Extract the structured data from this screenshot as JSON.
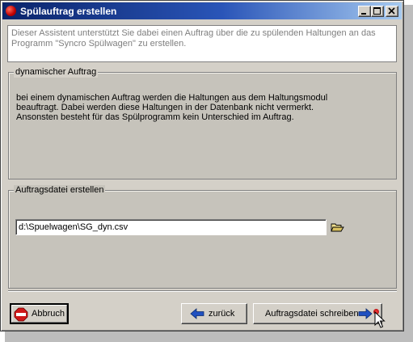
{
  "window": {
    "title": "Spülauftrag erstellen"
  },
  "intro_text": "Dieser Assistent unterstützt Sie dabei einen Auftrag über die zu spülenden Haltungen an das Programm \"Syncro Spülwagen\" zu erstellen.",
  "dynamic_group": {
    "legend": "dynamischer Auftrag",
    "description_lines": [
      "bei einem dynamischen Auftrag werden die Haltungen aus dem Haltungsmodul",
      "beauftragt. Dabei werden diese Haltungen in der Datenbank nicht vermerkt.",
      "Ansonsten besteht für das Spülprogramm kein Unterschied im Auftrag."
    ]
  },
  "file_group": {
    "legend": "Auftragsdatei erstellen",
    "path_value": "d:\\Spuelwagen\\SG_dyn.csv"
  },
  "buttons": {
    "abort_label": "Abbruch",
    "back_label": "zurück",
    "write_label": "Auftragsdatei schreiben"
  },
  "icons": {
    "app": "stop-sign-icon",
    "abort": "stop-sign-icon",
    "back": "arrow-left-icon",
    "write": "arrow-right-icon",
    "browse": "folder-open-icon"
  },
  "colors": {
    "titlebar_start": "#0a246a",
    "titlebar_end": "#a6caf0",
    "intro_text": "#7f7f7f",
    "arrow_blue": "#2050c0"
  }
}
